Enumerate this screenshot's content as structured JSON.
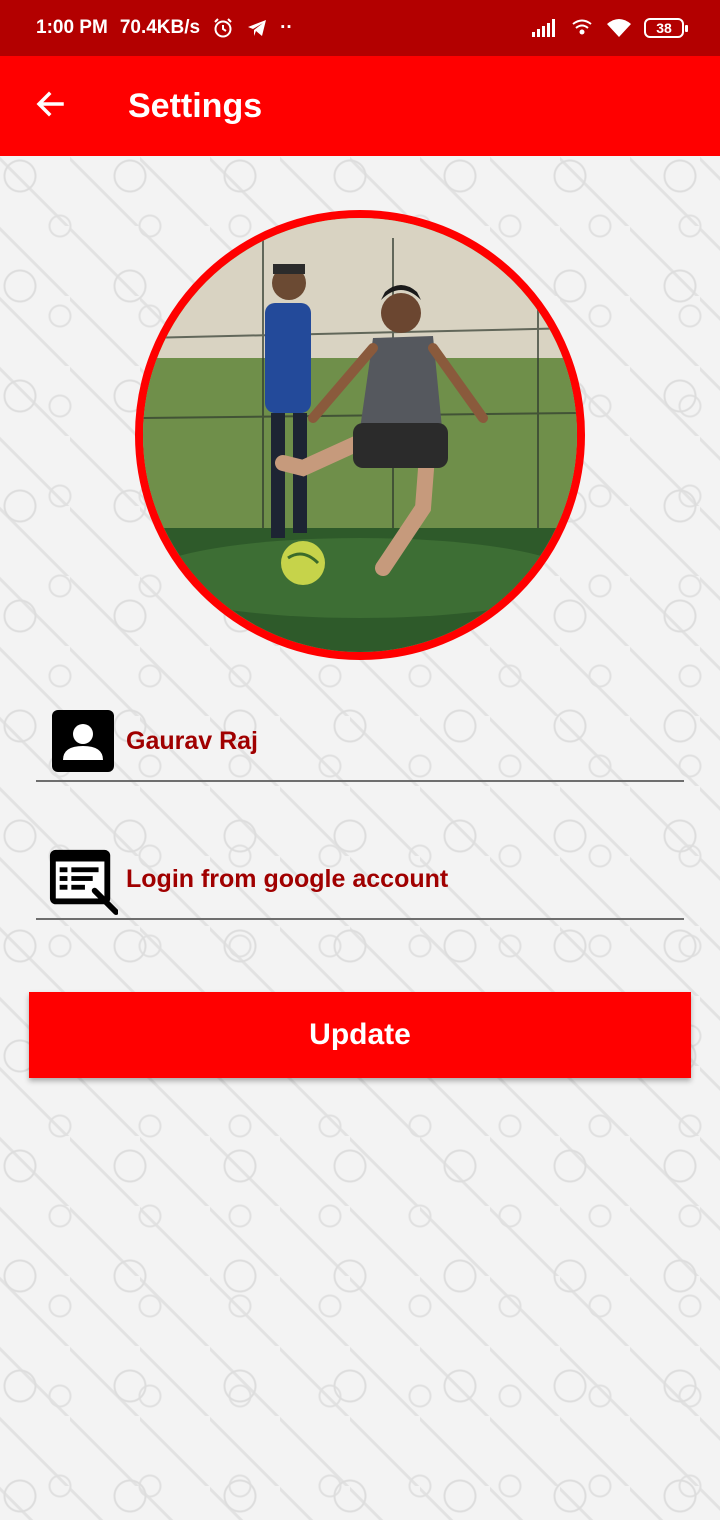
{
  "status_bar": {
    "time": "1:00 PM",
    "speed": "70.4KB/s",
    "dots": "··",
    "battery": "38",
    "icons": [
      "alarm-icon",
      "telegram-icon",
      "signal-icon",
      "hotspot-icon",
      "wifi-icon",
      "battery-icon"
    ]
  },
  "app_bar": {
    "title": "Settings",
    "back_icon": "arrow-back-icon",
    "background_color": "#ff0000"
  },
  "profile": {
    "photo_icon": "profile-photo",
    "name": "Gaurav Raj",
    "name_icon": "person-icon",
    "status": "Login from google account",
    "status_icon": "form-edit-icon"
  },
  "actions": {
    "update_label": "Update"
  },
  "colors": {
    "accent": "#ff0000",
    "status_bar": "#b30000",
    "field_text": "#a00000"
  }
}
